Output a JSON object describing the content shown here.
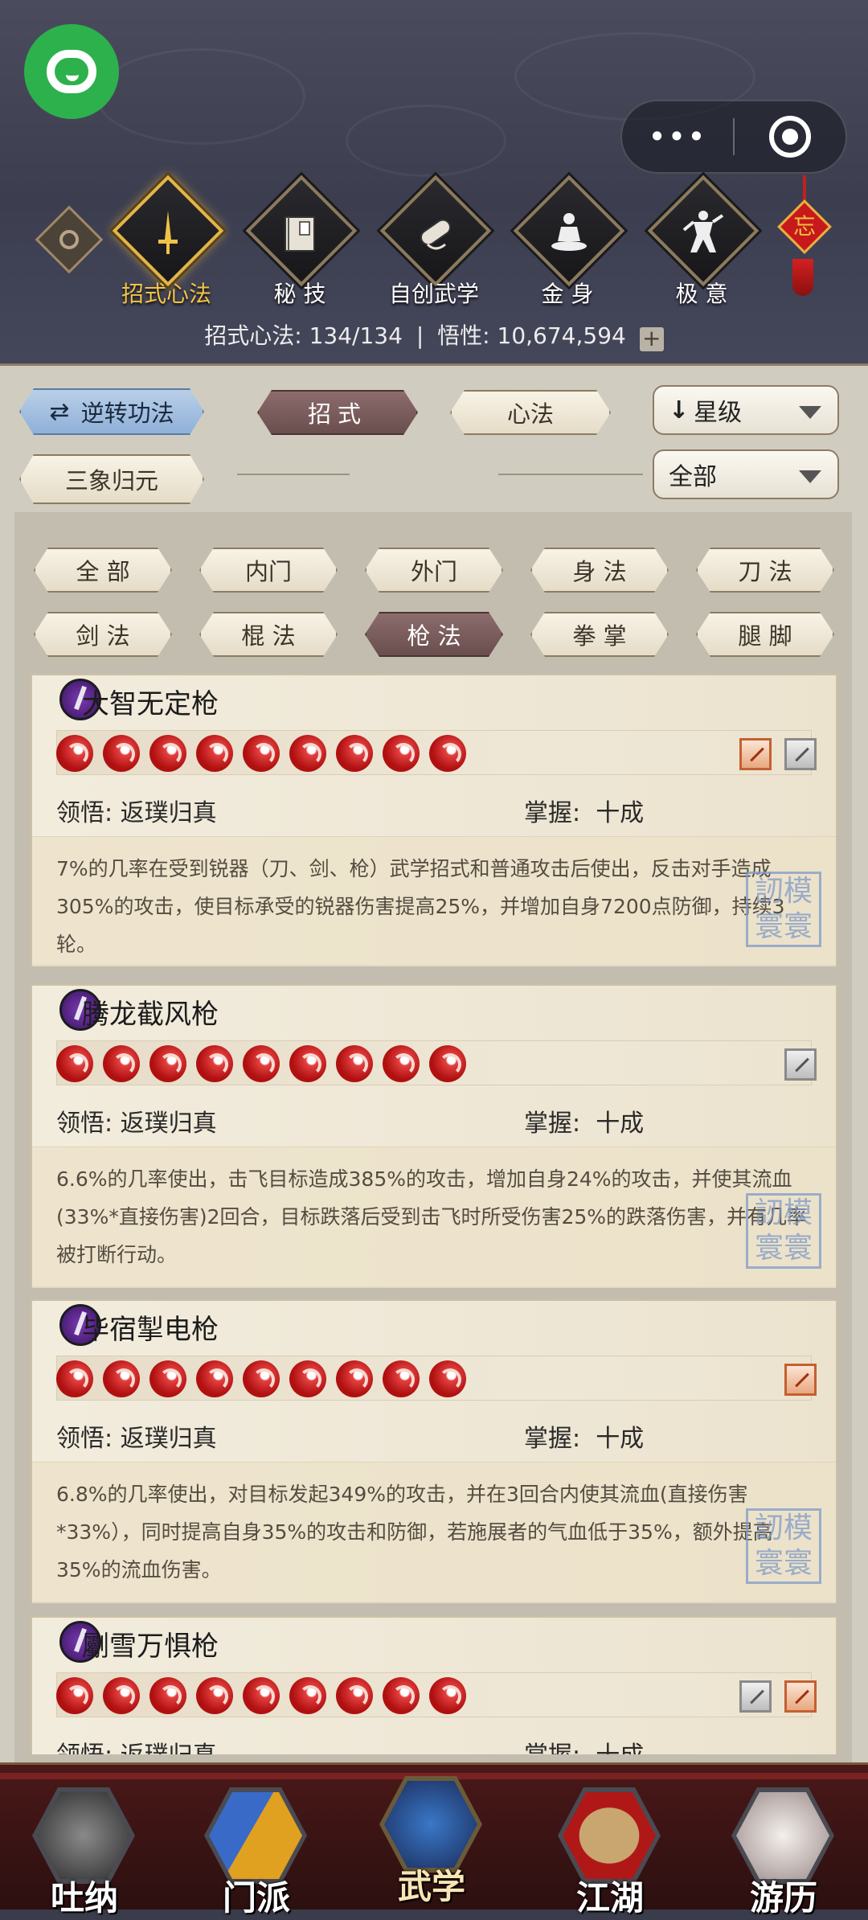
{
  "header": {
    "tabs": [
      {
        "label": "招式心法",
        "icon": "sword-icon",
        "active": true
      },
      {
        "label": "秘 技",
        "icon": "book-icon",
        "active": false
      },
      {
        "label": "自创武学",
        "icon": "scroll-icon",
        "active": false
      },
      {
        "label": "金 身",
        "icon": "meditation-icon",
        "active": false
      },
      {
        "label": "极 意",
        "icon": "martial-pose-icon",
        "active": false
      }
    ],
    "knot_char": "忘",
    "stats_label1": "招式心法:",
    "stats_value1": "134/134",
    "stats_label2": "悟性:",
    "stats_value2": "10,674,594"
  },
  "filters": {
    "reverse_btn": "逆转功法",
    "sanxiang_btn": "三象归元",
    "type_tabs": [
      "招式",
      "心法"
    ],
    "sort_select": "星级",
    "scope_select": "全部",
    "categories": [
      "全 部",
      "内门",
      "外门",
      "身 法",
      "刀 法",
      "剑 法",
      "棍 法",
      "枪 法",
      "拳 掌",
      "腿 脚"
    ],
    "selected_category": "枪 法"
  },
  "skills": [
    {
      "name": "大智无定枪",
      "stars": 9,
      "lingwu_label": "领悟:",
      "lingwu": "返璞归真",
      "zhangwo_label": "掌握:",
      "zhangwo": "十成",
      "desc": "7%的几率在受到锐器（刀、剑、枪）武学招式和普通攻击后使出，反击对手造成305%的攻击，使目标承受的锐器伤害提高25%，并增加自身7200点防御，持续3轮。"
    },
    {
      "name": "腾龙截风枪",
      "stars": 9,
      "lingwu_label": "领悟:",
      "lingwu": "返璞归真",
      "zhangwo_label": "掌握:",
      "zhangwo": "十成",
      "desc": "6.6%的几率使出，击飞目标造成385%的攻击，增加自身24%的攻击，并使其流血(33%*直接伤害)2回合，目标跌落后受到击飞时所受伤害25%的跌落伤害，并有几率被打断行动。"
    },
    {
      "name": "毕宿掣电枪",
      "stars": 9,
      "lingwu_label": "领悟:",
      "lingwu": "返璞归真",
      "zhangwo_label": "掌握:",
      "zhangwo": "十成",
      "desc": "6.8%的几率使出，对目标发起349%的攻击，并在3回合内使其流血(直接伤害*33%），同时提高自身35%的攻击和防御，若施展者的气血低于35%，额外提高35%的流血伤害。"
    },
    {
      "name": "劚雪万惧枪",
      "stars": 9,
      "lingwu_label": "领悟:",
      "lingwu": "返璞归真",
      "zhangwo_label": "掌握:",
      "zhangwo": "十成",
      "desc": ""
    }
  ],
  "seal_text": "訒模\n寰寰",
  "bottom_nav": [
    {
      "label": "吐纳"
    },
    {
      "label": "门派"
    },
    {
      "label": "武学",
      "active": true
    },
    {
      "label": "江湖"
    },
    {
      "label": "游历"
    }
  ],
  "colors": {
    "accent_gold": "#f3c443",
    "selected_pill": "#6a4e4e",
    "flame_red": "#c41a1a"
  }
}
